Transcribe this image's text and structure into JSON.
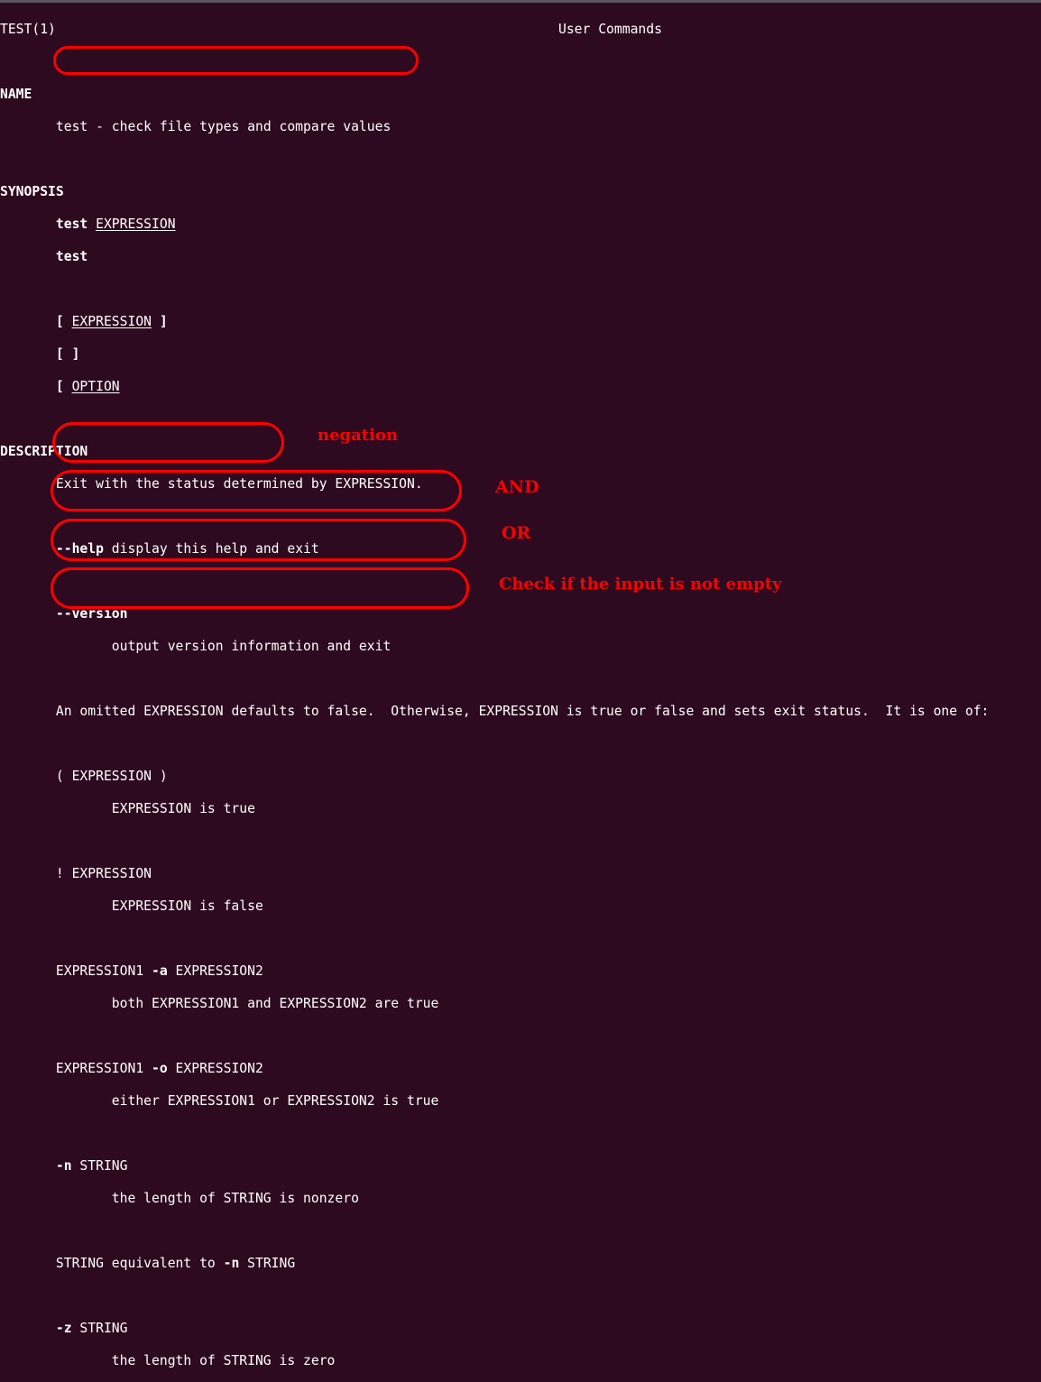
{
  "window": {
    "title_bar_color": "#5a5560",
    "background_color": "#2d0a20",
    "text_color": "#ffffff",
    "annotation_color": "#ff0000"
  },
  "header": {
    "left": "TEST(1)",
    "center": "User Commands"
  },
  "sections": {
    "name_heading": "NAME",
    "name_body": "test - check file types and compare values",
    "synopsis_heading": "SYNOPSIS",
    "synopsis": {
      "line1_cmd": "test",
      "line1_arg": "EXPRESSION",
      "line2_cmd": "test",
      "line3": {
        "open": "[ ",
        "arg": "EXPRESSION",
        "close": " ]"
      },
      "line4": "[ ]",
      "line5": {
        "open": "[ ",
        "arg": "OPTION"
      }
    },
    "description_heading": "DESCRIPTION",
    "description_intro": "Exit with the status determined by EXPRESSION.",
    "options": [
      {
        "flag": "--help",
        "text": " display this help and exit"
      },
      {
        "flag": "--version",
        "text": ""
      }
    ],
    "version_detail": "output version information and exit",
    "omitted_note": "An omitted EXPRESSION defaults to false.  Otherwise, EXPRESSION is true or false and sets exit status.  It is one of:",
    "expressions": [
      {
        "head": "( EXPRESSION )",
        "detail": "EXPRESSION is true"
      },
      {
        "head": "! EXPRESSION",
        "detail": "EXPRESSION is false"
      },
      {
        "head_pre": "EXPRESSION1 ",
        "head_flag": "-a",
        "head_post": " EXPRESSION2",
        "detail": "both EXPRESSION1 and EXPRESSION2 are true"
      },
      {
        "head_pre": "EXPRESSION1 ",
        "head_flag": "-o",
        "head_post": " EXPRESSION2",
        "detail": "either EXPRESSION1 or EXPRESSION2 is true"
      },
      {
        "head_flag": "-n",
        "head_post": " STRING",
        "detail": "the length of STRING is nonzero"
      },
      {
        "equiv_pre": "STRING equivalent to ",
        "equiv_flag": "-n",
        "equiv_post": " STRING"
      },
      {
        "head_flag": "-z",
        "head_post": " STRING",
        "detail": "the length of STRING is zero"
      }
    ]
  },
  "annotations": [
    {
      "label": "negation"
    },
    {
      "label": "AND"
    },
    {
      "label": "OR"
    },
    {
      "label": "Check if the input is not empty"
    }
  ]
}
